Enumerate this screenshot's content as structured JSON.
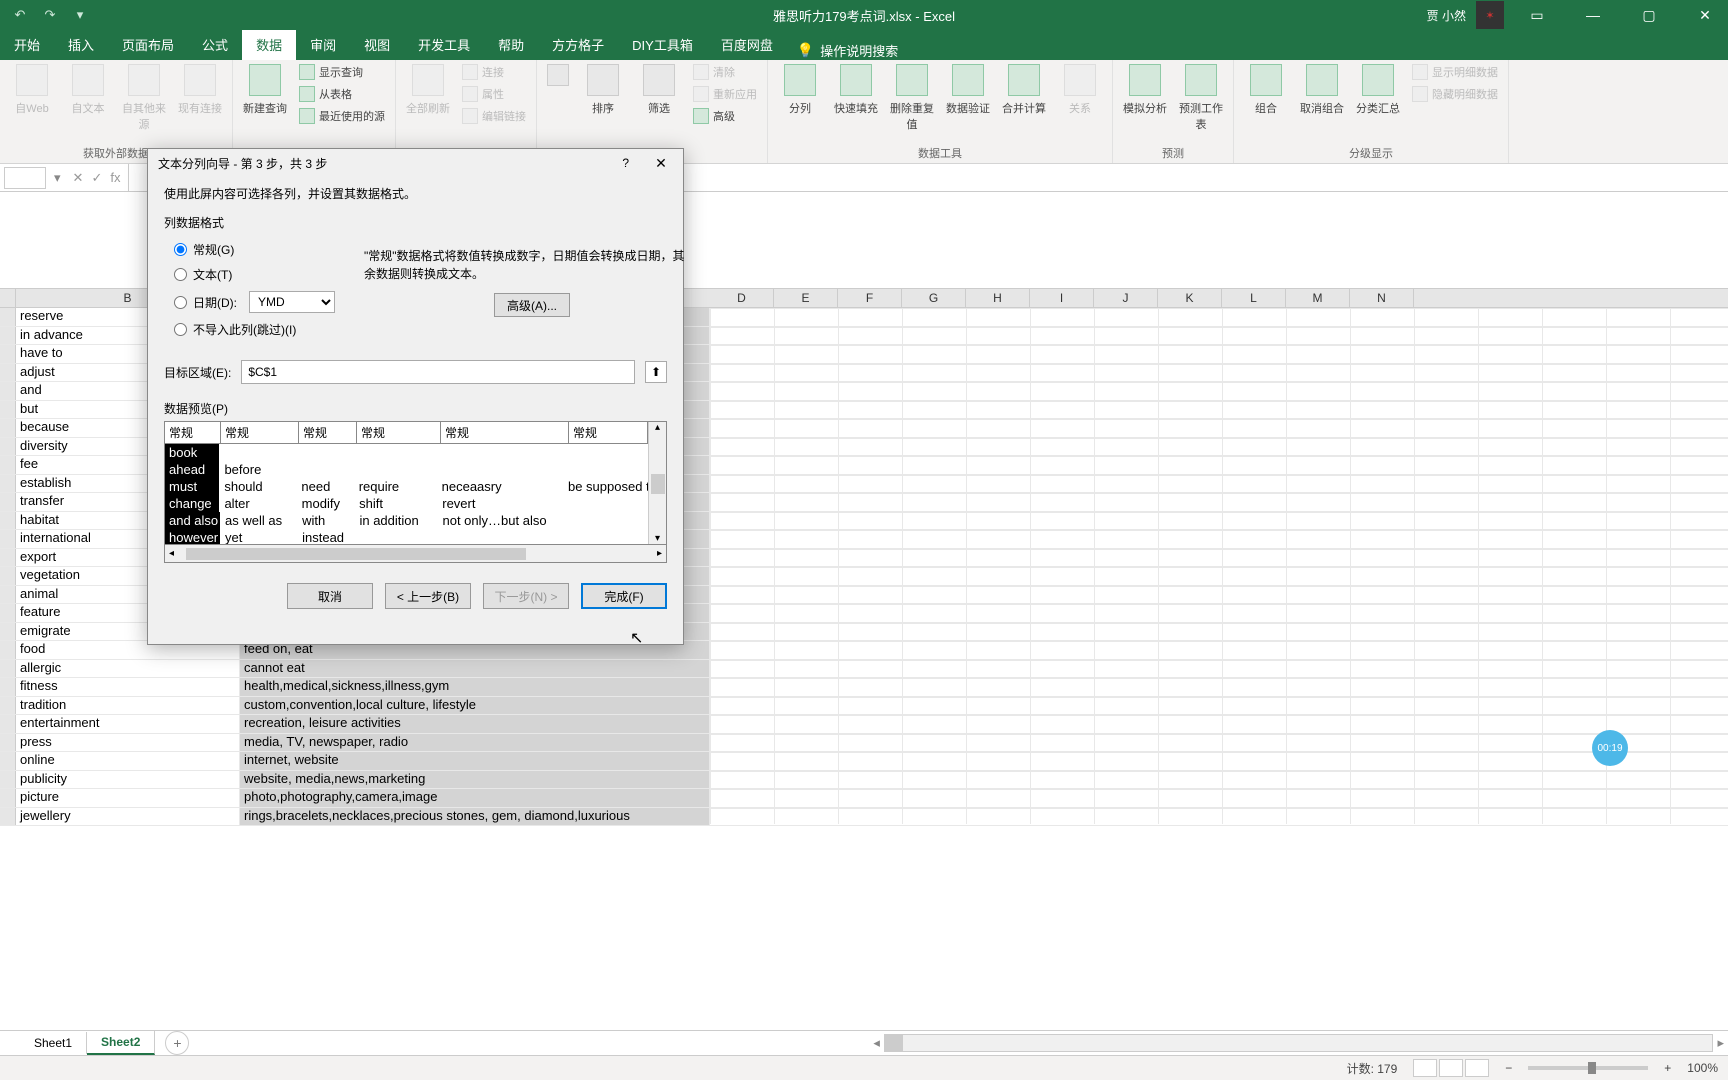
{
  "title": {
    "filename": "雅思听力179考点词.xlsx - Excel",
    "user": "贾 小然"
  },
  "tabs": [
    "开始",
    "插入",
    "页面布局",
    "公式",
    "数据",
    "审阅",
    "视图",
    "开发工具",
    "帮助",
    "方方格子",
    "DIY工具箱",
    "百度网盘"
  ],
  "tellme": "操作说明搜索",
  "ribbon": {
    "group1": {
      "label": "获取外部数据",
      "btns": [
        "自Web",
        "自文本",
        "自其他来源",
        "现有连接"
      ]
    },
    "group2": {
      "label": "",
      "btn": "新建查询",
      "small": [
        "显示查询",
        "从表格",
        "最近使用的源"
      ]
    },
    "group3": {
      "label": "",
      "btn": "全部刷新",
      "small": [
        "连接",
        "属性",
        "编辑链接"
      ]
    },
    "group4": {
      "label": "",
      "sort": "排序",
      "filter": "筛选",
      "small": [
        "清除",
        "重新应用",
        "高级"
      ]
    },
    "group5": {
      "label": "数据工具",
      "btns": [
        "分列",
        "快速填充",
        "删除重复值",
        "数据验证",
        "合并计算",
        "关系"
      ]
    },
    "group6": {
      "label": "预测",
      "btns": [
        "模拟分析",
        "预测工作表"
      ]
    },
    "group7": {
      "label": "分级显示",
      "btns": [
        "组合",
        "取消组合",
        "分类汇总"
      ],
      "small": [
        "显示明细数据",
        "隐藏明细数据"
      ]
    }
  },
  "columns": [
    "B",
    "D",
    "E",
    "F",
    "G",
    "H",
    "I",
    "J",
    "K",
    "L",
    "M",
    "N"
  ],
  "colB": [
    "reserve",
    "in advance",
    "have to",
    "adjust",
    "and",
    "but",
    "because",
    "diversity",
    "fee",
    "establish",
    "transfer",
    "habitat",
    "international",
    "export",
    "vegetation",
    "animal",
    "feature",
    "emigrate",
    "food",
    "allergic",
    "fitness",
    "tradition",
    "entertainment",
    "press",
    "online",
    "publicity",
    "picture",
    "jewellery"
  ],
  "colC": {
    "food": "feed on, eat",
    "allergic": "cannot eat",
    "fitness": "health,medical,sickness,illness,gym",
    "tradition": "custom,convention,local culture, lifestyle",
    "entertainment": "recreation, leisure activities",
    "press": "media, TV, newspaper, radio",
    "online": "internet, website",
    "publicity": "website, media,news,marketing",
    "picture": "photo,photography,camera,image",
    "jewellery": "rings,bracelets,necklaces,precious stones, gem, diamond,luxurious"
  },
  "dialog": {
    "title": "文本分列向导 - 第 3 步，共 3 步",
    "intro": "使用此屏内容可选择各列，并设置其数据格式。",
    "fieldsetLabel": "列数据格式",
    "radios": {
      "general": "常规(G)",
      "text": "文本(T)",
      "date": "日期(D):",
      "skip": "不导入此列(跳过)(I)"
    },
    "dateFormat": "YMD",
    "note": "\"常规\"数据格式将数值转换成数字，日期值会转换成日期，其余数据则转换成文本。",
    "advanced": "高级(A)...",
    "targetLabel": "目标区域(E):",
    "targetValue": "$C$1",
    "previewLabel": "数据预览(P)",
    "previewHead": [
      "常规",
      "常规",
      "常规",
      "常规",
      "常规",
      "常规"
    ],
    "previewRows": [
      [
        "book",
        "",
        "",
        "",
        "",
        ""
      ],
      [
        "ahead",
        "before",
        "",
        "",
        "",
        ""
      ],
      [
        "must",
        "should",
        "need",
        "require",
        "neceaasry",
        "be supposed t"
      ],
      [
        "change",
        "alter",
        "modify",
        "shift",
        "revert",
        ""
      ],
      [
        "and also",
        "as well as",
        "with",
        "in addition",
        "not only…but also",
        ""
      ],
      [
        "however",
        "yet",
        "instead",
        "",
        "",
        ""
      ]
    ],
    "btns": {
      "cancel": "取消",
      "back": "< 上一步(B)",
      "next": "下一步(N) >",
      "finish": "完成(F)"
    }
  },
  "sheets": [
    "Sheet1",
    "Sheet2"
  ],
  "status": {
    "count": "计数: 179",
    "zoom": "100%"
  },
  "timer": "00:19"
}
